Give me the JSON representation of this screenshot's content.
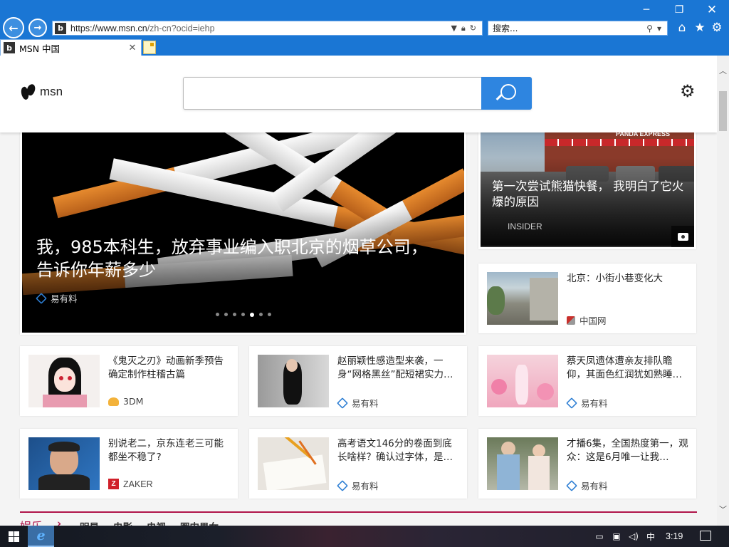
{
  "browser": {
    "url_prefix": "https://www.msn.cn",
    "url_path": "/zh-cn?ocid=iehp",
    "search_placeholder": "搜索...",
    "tab_title": "MSN 中国",
    "favicon_letter": "b"
  },
  "msn": {
    "logo_text": "msn"
  },
  "hero": {
    "title": "我，985本科生，放弃事业编入职北京的烟草公司，告诉你年薪多少",
    "source": "易有料",
    "slide_count": 7,
    "active_slide": 5
  },
  "top_right": {
    "title": "第一次尝试熊猫快餐， 我明白了它火爆的原因",
    "source": "INSIDER",
    "sign_text": "PANDA EXPRESS"
  },
  "cards": [
    {
      "title": "北京：小街小巷变化大",
      "source": "中国网",
      "icon": "chinanet"
    },
    {
      "title": "《鬼灭之刃》动画新季预告确定制作柱稽古篇",
      "source": "3DM",
      "icon": "3dm"
    },
    {
      "title": "赵丽颖性感造型来袭，一身“网格黑丝”配短裙实力…",
      "source": "易有料",
      "icon": "yiyouliao"
    },
    {
      "title": "蔡天凤遗体遭亲友排队瞻仰，其面色红润犹如熟睡…",
      "source": "易有料",
      "icon": "yiyouliao"
    },
    {
      "title": "别说老二，京东连老三可能都坐不稳了?",
      "source": "ZAKER",
      "icon": "zaker"
    },
    {
      "title": "高考语文146分的卷面到底长啥样？确认过字体，是…",
      "source": "易有料",
      "icon": "yiyouliao"
    },
    {
      "title": "才播6集，全国热度第一，观众：这是6月唯一让我…",
      "source": "易有料",
      "icon": "yiyouliao"
    }
  ],
  "section": {
    "title": "娱乐",
    "arrow": "›",
    "links": [
      "明星",
      "电影",
      "电视",
      "圈内男女"
    ]
  },
  "taskbar": {
    "ime": "中",
    "clock": "3:19"
  },
  "colors": {
    "chrome_blue": "#1a76d4",
    "search_blue": "#2e85e0",
    "section_accent": "#b0144a"
  }
}
